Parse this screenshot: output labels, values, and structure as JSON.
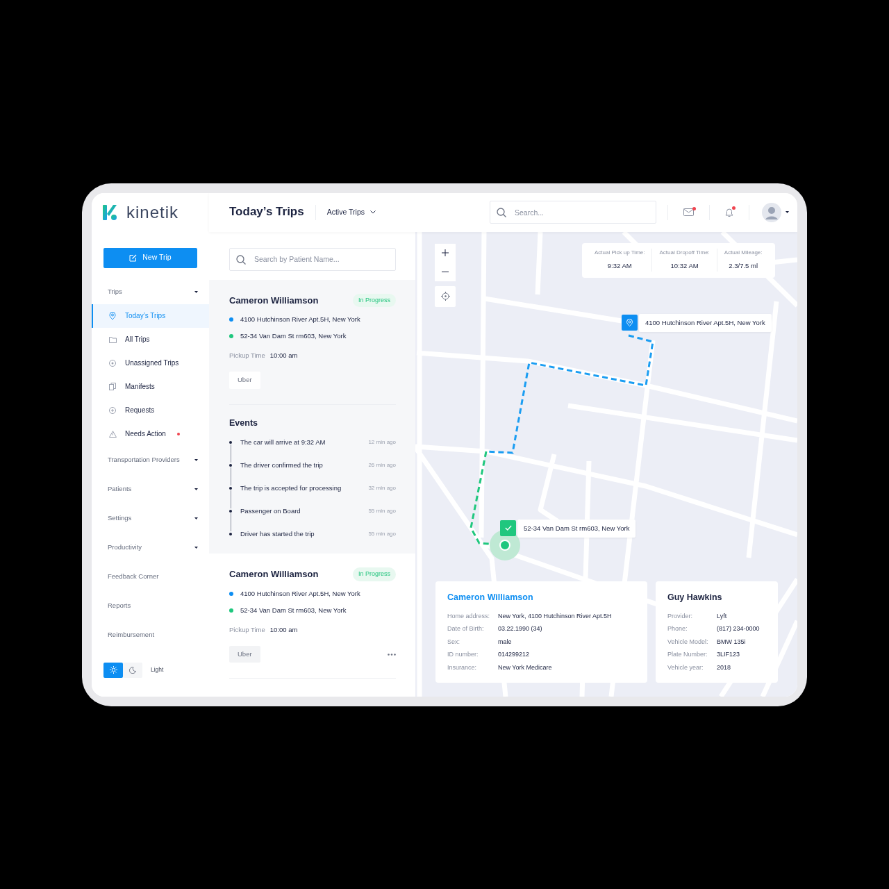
{
  "sidebar": {
    "logo": "kinetik",
    "new_trip_button": "New Trip",
    "nav": [
      {
        "label": "Trips",
        "kind": "group",
        "children": [
          {
            "label": "Today’s Trips",
            "selected": true,
            "alert": false
          },
          {
            "label": "All Trips",
            "selected": false,
            "alert": false
          },
          {
            "label": "Unassigned Trips",
            "selected": false,
            "alert": false
          },
          {
            "label": "Manifests",
            "selected": false,
            "alert": false
          },
          {
            "label": "Requests",
            "selected": false,
            "alert": false
          },
          {
            "label": "Needs Action",
            "selected": false,
            "alert": true
          }
        ]
      },
      {
        "label": "Transportation Providers",
        "kind": "group"
      },
      {
        "label": "Patients",
        "kind": "group"
      },
      {
        "label": "Settings",
        "kind": "group"
      },
      {
        "label": "Productivity",
        "kind": "group"
      },
      {
        "label": "Feedback Corner",
        "kind": "link"
      },
      {
        "label": "Reports",
        "kind": "link"
      },
      {
        "label": "Reimbursement",
        "kind": "link"
      }
    ],
    "theme": {
      "label": "Light",
      "options": [
        {
          "kind": "light",
          "selected": true
        },
        {
          "kind": "dark",
          "selected": false
        }
      ]
    }
  },
  "header": {
    "title": "Today’s Trips",
    "filter": "Active Trips",
    "search": {
      "placeholder": "Search..."
    },
    "mail": {
      "unread": true
    },
    "notifications": {
      "unread": true
    }
  },
  "trip_list": {
    "search": {
      "placeholder": "Search by Patient Name..."
    },
    "trips": [
      {
        "name": "Cameron Williamson",
        "status": "In Progress",
        "selected": true,
        "stops": [
          {
            "kind": "pickup",
            "address": "4100 Hutchinson River Apt.5H, New York"
          },
          {
            "kind": "dropoff",
            "address": "52-34 Van Dam St rm603, New York"
          }
        ],
        "pickup_label": "Pickup Time",
        "pickup_time": "10:00 am",
        "provider": "Uber",
        "more_button": false,
        "events_title": "Events",
        "events": [
          {
            "text": "The car will arrive at 9:32 AM",
            "time": "12 min ago"
          },
          {
            "text": "The driver confirmed the trip",
            "time": "26 min ago"
          },
          {
            "text": "The trip is accepted for processing",
            "time": "32 min ago"
          },
          {
            "text": "Passenger on Board",
            "time": "55 min ago"
          },
          {
            "text": "Driver has started the trip",
            "time": "55 min ago"
          }
        ]
      },
      {
        "name": "Cameron Williamson",
        "status": "In Progress",
        "selected": false,
        "stops": [
          {
            "kind": "pickup",
            "address": "4100 Hutchinson River Apt.5H, New York"
          },
          {
            "kind": "dropoff",
            "address": "52-34 Van Dam St rm603, New York"
          }
        ],
        "pickup_label": "Pickup Time",
        "pickup_time": "10:00 am",
        "provider": "Uber",
        "more_button": true
      }
    ]
  },
  "map": {
    "stats": [
      {
        "label": "Actual Pick up Time:",
        "value": "9:32 AM"
      },
      {
        "label": "Actual Dropoff Time:",
        "value": "10:32 AM"
      },
      {
        "label": "Actual Mileage:",
        "value": "2.3/7.5 ml"
      }
    ],
    "markers": [
      {
        "kind": "pickup",
        "address": "4100 Hutchinson River Apt.5H, New York"
      },
      {
        "kind": "dropoff",
        "address": "52-34 Van Dam St rm603, New York"
      }
    ],
    "patient_card": {
      "name": "Cameron Williamson",
      "fields": [
        {
          "label": "Home address:",
          "value": "New York, 4100 Hutchinson River Apt.5H"
        },
        {
          "label": "Date of Birth:",
          "value": "03.22.1990 (34)"
        },
        {
          "label": "Sex:",
          "value": "male"
        },
        {
          "label": "ID number:",
          "value": "014299212"
        },
        {
          "label": "Insurance:",
          "value": "New York Medicare"
        }
      ]
    },
    "driver_card": {
      "name": "Guy Hawkins",
      "fields": [
        {
          "label": "Provider:",
          "value": "Lyft"
        },
        {
          "label": "Phone:",
          "value": "(817) 234-0000"
        },
        {
          "label": "Vehicle Model:",
          "value": "BMW 135i"
        },
        {
          "label": "Plate Number:",
          "value": "3LIF123"
        },
        {
          "label": "Vehicle year:",
          "value": "2018"
        }
      ]
    }
  }
}
